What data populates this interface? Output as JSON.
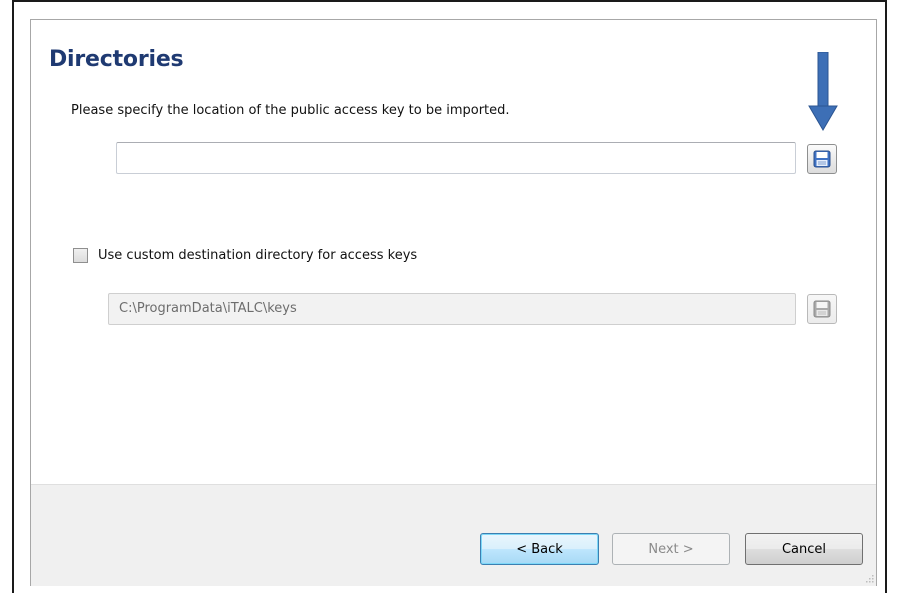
{
  "dialog": {
    "title": "Directories",
    "key_location_prompt": "Please specify the location of the public access key to be imported.",
    "key_location_value": "",
    "custom_dest_checkbox_label": "Use custom destination directory for access keys",
    "custom_dest_checked": false,
    "custom_dest_path": "C:\\ProgramData\\iTALC\\keys"
  },
  "buttons": {
    "back": "< Back",
    "next": "Next >",
    "cancel": "Cancel"
  },
  "icons": {
    "browse": "floppy-disk-icon",
    "annotation": "down-arrow-icon"
  },
  "colors": {
    "title": "#1f3a72",
    "arrow": "#3d6fb6",
    "footer": "#f0f0f0"
  }
}
